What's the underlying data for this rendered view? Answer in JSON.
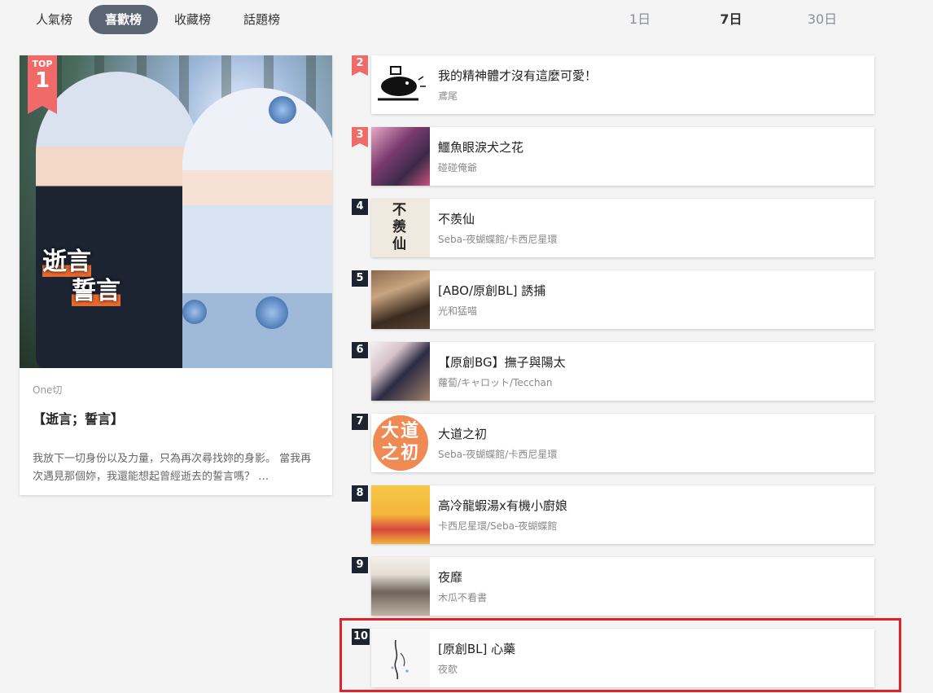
{
  "tabs": [
    "人氣榜",
    "喜歡榜",
    "收藏榜",
    "話題榜"
  ],
  "active_tab": 1,
  "periods": [
    "1日",
    "7日",
    "30日"
  ],
  "active_period": 1,
  "top_item": {
    "badge_top": "TOP",
    "badge_rank": "1",
    "cover_line1": "逝言",
    "cover_line2": "誓言",
    "author": "One切",
    "title": "【逝言；誓言】",
    "description": "我放下一切身份以及力量，只為再次尋找妳的身影。 當我再次遇見那個妳，我還能想起曾經逝去的誓言嗎？ …"
  },
  "items": [
    {
      "rank": "2",
      "title": "我的精神體才沒有這麼可愛！",
      "author": "鳶尾"
    },
    {
      "rank": "3",
      "title": "鱷魚眼淚犬之花",
      "author": "碰碰俺爺"
    },
    {
      "rank": "4",
      "title": "不羨仙",
      "author": "Seba-夜蝴蝶館/卡西尼星環"
    },
    {
      "rank": "5",
      "title": "[ABO/原創BL] 誘捕",
      "author": "光和猛喵"
    },
    {
      "rank": "6",
      "title": "【原創BG】撫子與陽太",
      "author": "蘿蔔/キャロット/Tecchan"
    },
    {
      "rank": "7",
      "title": "大道之初",
      "author": "Seba-夜蝴蝶館/卡西尼星環"
    },
    {
      "rank": "8",
      "title": "高冷龍蝦湯x有機小廚娘",
      "author": "卡西尼星環/Seba-夜蝴蝶館"
    },
    {
      "rank": "9",
      "title": "夜靡",
      "author": "木瓜不看書"
    },
    {
      "rank": "10",
      "title": "[原創BL] 心藥",
      "author": "夜欹"
    }
  ],
  "thumb_texts": {
    "t4": "不羨仙",
    "t7": "大道之初"
  },
  "colors": {
    "accent_tab": "#5a6472",
    "rank_hot": "#f06a6a",
    "rank_default": "#1e2330",
    "highlight": "#e0232a"
  }
}
